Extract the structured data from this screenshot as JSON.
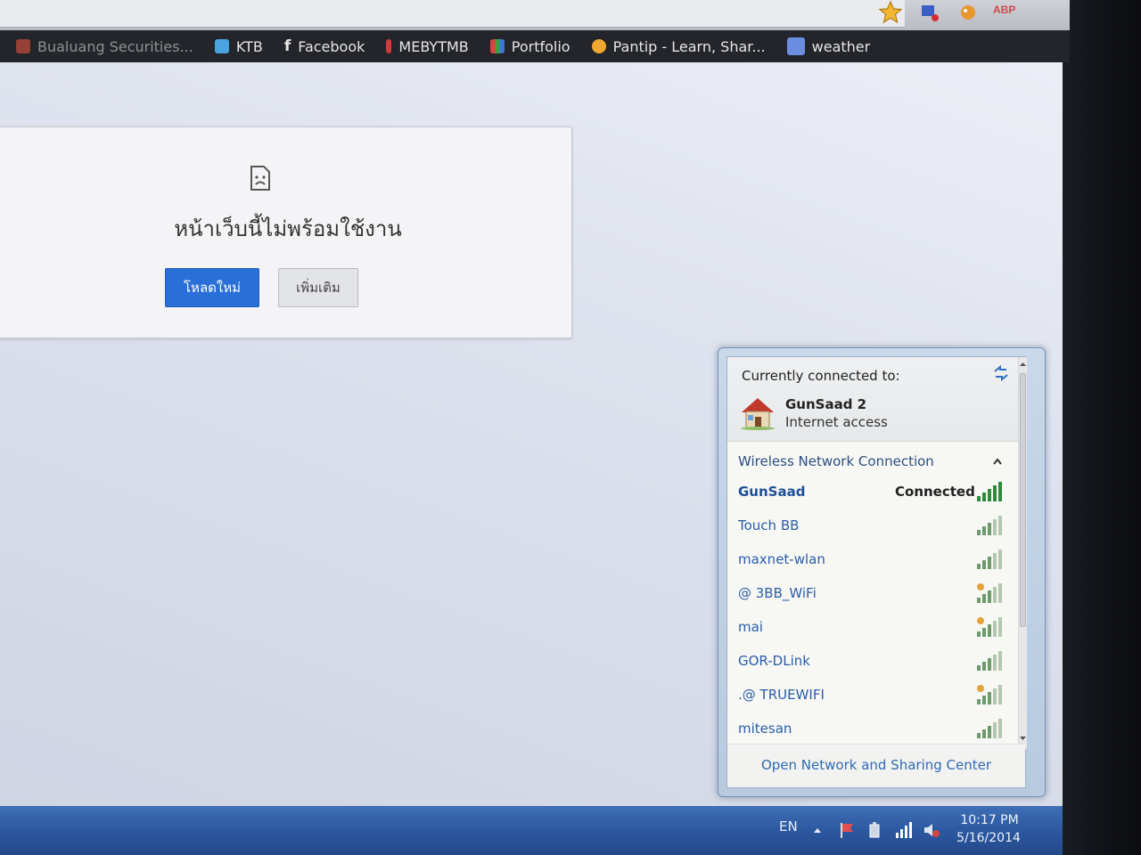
{
  "bookmarks": [
    {
      "label": "Bualuang Securities...",
      "icon": "bualuang-icon",
      "color": "#c84d3c"
    },
    {
      "label": "KTB",
      "icon": "ktb-icon",
      "color": "#4aa3df"
    },
    {
      "label": "Facebook",
      "icon": "facebook-icon",
      "color": "#e6e6e6"
    },
    {
      "label": "MEBYTMB",
      "icon": "mebytmb-icon",
      "color": "#d33a3a"
    },
    {
      "label": "Portfolio",
      "icon": "portfolio-icon",
      "color": "#3c78d8"
    },
    {
      "label": "Pantip - Learn, Shar...",
      "icon": "pantip-icon",
      "color": "#f0a830"
    },
    {
      "label": "weather",
      "icon": "weather-icon",
      "color": "#6b8ee0"
    }
  ],
  "toolbar": {
    "extension_abp": "ABP"
  },
  "error_page": {
    "title": "หน้าเว็บนี้ไม่พร้อมใช้งาน",
    "reload_label": "โหลดใหม่",
    "more_label": "เพิ่มเติม"
  },
  "network_flyout": {
    "header": "Currently connected to:",
    "current_network": "GunSaad  2",
    "current_status": "Internet access",
    "section": "Wireless Network Connection",
    "networks": [
      {
        "name": "GunSaad",
        "state": "Connected"
      },
      {
        "name": "Touch BB",
        "state": ""
      },
      {
        "name": "maxnet-wlan",
        "state": ""
      },
      {
        "name": "@ 3BB_WiFi",
        "state": ""
      },
      {
        "name": "mai",
        "state": ""
      },
      {
        "name": "GOR-DLink",
        "state": ""
      },
      {
        "name": ".@  TRUEWIFI",
        "state": ""
      },
      {
        "name": "mitesan",
        "state": ""
      }
    ],
    "footer_link": "Open Network and Sharing Center"
  },
  "taskbar": {
    "language": "EN",
    "time": "10:17 PM",
    "date": "5/16/2014"
  }
}
